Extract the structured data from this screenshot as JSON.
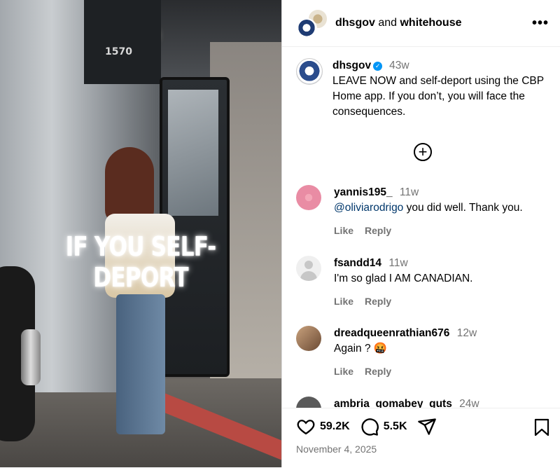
{
  "media": {
    "overlay_text": "IF YOU SELF-DEPORT",
    "bus_number": "1570"
  },
  "header": {
    "user1": "dhsgov",
    "joiner": " and ",
    "user2": "whitehouse",
    "more_label": "•••"
  },
  "caption": {
    "username": "dhsgov",
    "time": "43w",
    "text": "LEAVE NOW and self-deport using the CBP Home app. If you don’t, you will face the consequences."
  },
  "load_more_label": "+",
  "comments": [
    {
      "username": "yannis195_",
      "time": "11w",
      "mention": "@oliviarodrigo",
      "text": " you did well. Thank you.",
      "like": "Like",
      "reply": "Reply",
      "avatar_color": "#e98ca4"
    },
    {
      "username": "fsandd14",
      "time": "11w",
      "mention": "",
      "text": "I'm so glad I AM CANADIAN.",
      "like": "Like",
      "reply": "Reply",
      "avatar_color": "#dbdbdb"
    },
    {
      "username": "dreadqueenrathian676",
      "time": "12w",
      "mention": "",
      "text": "Again ? 🤬",
      "like": "Like",
      "reply": "Reply",
      "avatar_color": "#8a6a50"
    },
    {
      "username": "ambria_gomabey_guts",
      "time": "24w"
    }
  ],
  "footer": {
    "likes": "59.2K",
    "comments": "5.5K",
    "date": "November 4, 2025"
  }
}
